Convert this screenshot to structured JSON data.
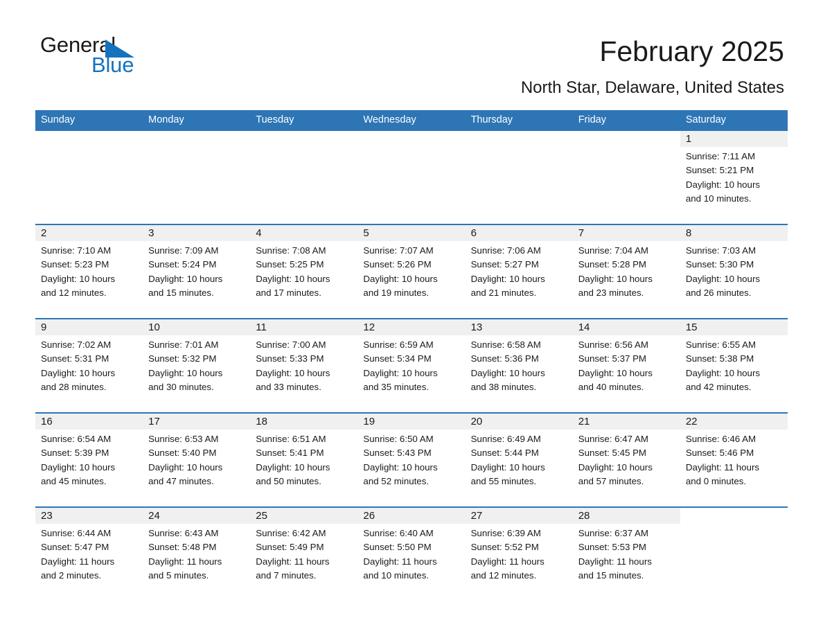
{
  "brand": {
    "name_part1": "General",
    "name_part2": "Blue",
    "accent_color": "#1572bd"
  },
  "header": {
    "title": "February 2025",
    "subtitle": "North Star, Delaware, United States",
    "header_bg_color": "#2e75b6"
  },
  "weekday_headers": [
    "Sunday",
    "Monday",
    "Tuesday",
    "Wednesday",
    "Thursday",
    "Friday",
    "Saturday"
  ],
  "labels": {
    "sunrise_prefix": "Sunrise:",
    "sunset_prefix": "Sunset:",
    "daylight_prefix": "Daylight:"
  },
  "weeks": [
    [
      {
        "day": "",
        "line1": "",
        "line2": "",
        "line3": "",
        "line4": ""
      },
      {
        "day": "",
        "line1": "",
        "line2": "",
        "line3": "",
        "line4": ""
      },
      {
        "day": "",
        "line1": "",
        "line2": "",
        "line3": "",
        "line4": ""
      },
      {
        "day": "",
        "line1": "",
        "line2": "",
        "line3": "",
        "line4": ""
      },
      {
        "day": "",
        "line1": "",
        "line2": "",
        "line3": "",
        "line4": ""
      },
      {
        "day": "",
        "line1": "",
        "line2": "",
        "line3": "",
        "line4": ""
      },
      {
        "day": "1",
        "line1": "Sunrise: 7:11 AM",
        "line2": "Sunset: 5:21 PM",
        "line3": "Daylight: 10 hours",
        "line4": "and 10 minutes."
      }
    ],
    [
      {
        "day": "2",
        "line1": "Sunrise: 7:10 AM",
        "line2": "Sunset: 5:23 PM",
        "line3": "Daylight: 10 hours",
        "line4": "and 12 minutes."
      },
      {
        "day": "3",
        "line1": "Sunrise: 7:09 AM",
        "line2": "Sunset: 5:24 PM",
        "line3": "Daylight: 10 hours",
        "line4": "and 15 minutes."
      },
      {
        "day": "4",
        "line1": "Sunrise: 7:08 AM",
        "line2": "Sunset: 5:25 PM",
        "line3": "Daylight: 10 hours",
        "line4": "and 17 minutes."
      },
      {
        "day": "5",
        "line1": "Sunrise: 7:07 AM",
        "line2": "Sunset: 5:26 PM",
        "line3": "Daylight: 10 hours",
        "line4": "and 19 minutes."
      },
      {
        "day": "6",
        "line1": "Sunrise: 7:06 AM",
        "line2": "Sunset: 5:27 PM",
        "line3": "Daylight: 10 hours",
        "line4": "and 21 minutes."
      },
      {
        "day": "7",
        "line1": "Sunrise: 7:04 AM",
        "line2": "Sunset: 5:28 PM",
        "line3": "Daylight: 10 hours",
        "line4": "and 23 minutes."
      },
      {
        "day": "8",
        "line1": "Sunrise: 7:03 AM",
        "line2": "Sunset: 5:30 PM",
        "line3": "Daylight: 10 hours",
        "line4": "and 26 minutes."
      }
    ],
    [
      {
        "day": "9",
        "line1": "Sunrise: 7:02 AM",
        "line2": "Sunset: 5:31 PM",
        "line3": "Daylight: 10 hours",
        "line4": "and 28 minutes."
      },
      {
        "day": "10",
        "line1": "Sunrise: 7:01 AM",
        "line2": "Sunset: 5:32 PM",
        "line3": "Daylight: 10 hours",
        "line4": "and 30 minutes."
      },
      {
        "day": "11",
        "line1": "Sunrise: 7:00 AM",
        "line2": "Sunset: 5:33 PM",
        "line3": "Daylight: 10 hours",
        "line4": "and 33 minutes."
      },
      {
        "day": "12",
        "line1": "Sunrise: 6:59 AM",
        "line2": "Sunset: 5:34 PM",
        "line3": "Daylight: 10 hours",
        "line4": "and 35 minutes."
      },
      {
        "day": "13",
        "line1": "Sunrise: 6:58 AM",
        "line2": "Sunset: 5:36 PM",
        "line3": "Daylight: 10 hours",
        "line4": "and 38 minutes."
      },
      {
        "day": "14",
        "line1": "Sunrise: 6:56 AM",
        "line2": "Sunset: 5:37 PM",
        "line3": "Daylight: 10 hours",
        "line4": "and 40 minutes."
      },
      {
        "day": "15",
        "line1": "Sunrise: 6:55 AM",
        "line2": "Sunset: 5:38 PM",
        "line3": "Daylight: 10 hours",
        "line4": "and 42 minutes."
      }
    ],
    [
      {
        "day": "16",
        "line1": "Sunrise: 6:54 AM",
        "line2": "Sunset: 5:39 PM",
        "line3": "Daylight: 10 hours",
        "line4": "and 45 minutes."
      },
      {
        "day": "17",
        "line1": "Sunrise: 6:53 AM",
        "line2": "Sunset: 5:40 PM",
        "line3": "Daylight: 10 hours",
        "line4": "and 47 minutes."
      },
      {
        "day": "18",
        "line1": "Sunrise: 6:51 AM",
        "line2": "Sunset: 5:41 PM",
        "line3": "Daylight: 10 hours",
        "line4": "and 50 minutes."
      },
      {
        "day": "19",
        "line1": "Sunrise: 6:50 AM",
        "line2": "Sunset: 5:43 PM",
        "line3": "Daylight: 10 hours",
        "line4": "and 52 minutes."
      },
      {
        "day": "20",
        "line1": "Sunrise: 6:49 AM",
        "line2": "Sunset: 5:44 PM",
        "line3": "Daylight: 10 hours",
        "line4": "and 55 minutes."
      },
      {
        "day": "21",
        "line1": "Sunrise: 6:47 AM",
        "line2": "Sunset: 5:45 PM",
        "line3": "Daylight: 10 hours",
        "line4": "and 57 minutes."
      },
      {
        "day": "22",
        "line1": "Sunrise: 6:46 AM",
        "line2": "Sunset: 5:46 PM",
        "line3": "Daylight: 11 hours",
        "line4": "and 0 minutes."
      }
    ],
    [
      {
        "day": "23",
        "line1": "Sunrise: 6:44 AM",
        "line2": "Sunset: 5:47 PM",
        "line3": "Daylight: 11 hours",
        "line4": "and 2 minutes."
      },
      {
        "day": "24",
        "line1": "Sunrise: 6:43 AM",
        "line2": "Sunset: 5:48 PM",
        "line3": "Daylight: 11 hours",
        "line4": "and 5 minutes."
      },
      {
        "day": "25",
        "line1": "Sunrise: 6:42 AM",
        "line2": "Sunset: 5:49 PM",
        "line3": "Daylight: 11 hours",
        "line4": "and 7 minutes."
      },
      {
        "day": "26",
        "line1": "Sunrise: 6:40 AM",
        "line2": "Sunset: 5:50 PM",
        "line3": "Daylight: 11 hours",
        "line4": "and 10 minutes."
      },
      {
        "day": "27",
        "line1": "Sunrise: 6:39 AM",
        "line2": "Sunset: 5:52 PM",
        "line3": "Daylight: 11 hours",
        "line4": "and 12 minutes."
      },
      {
        "day": "28",
        "line1": "Sunrise: 6:37 AM",
        "line2": "Sunset: 5:53 PM",
        "line3": "Daylight: 11 hours",
        "line4": "and 15 minutes."
      },
      {
        "day": "",
        "line1": "",
        "line2": "",
        "line3": "",
        "line4": ""
      }
    ]
  ]
}
